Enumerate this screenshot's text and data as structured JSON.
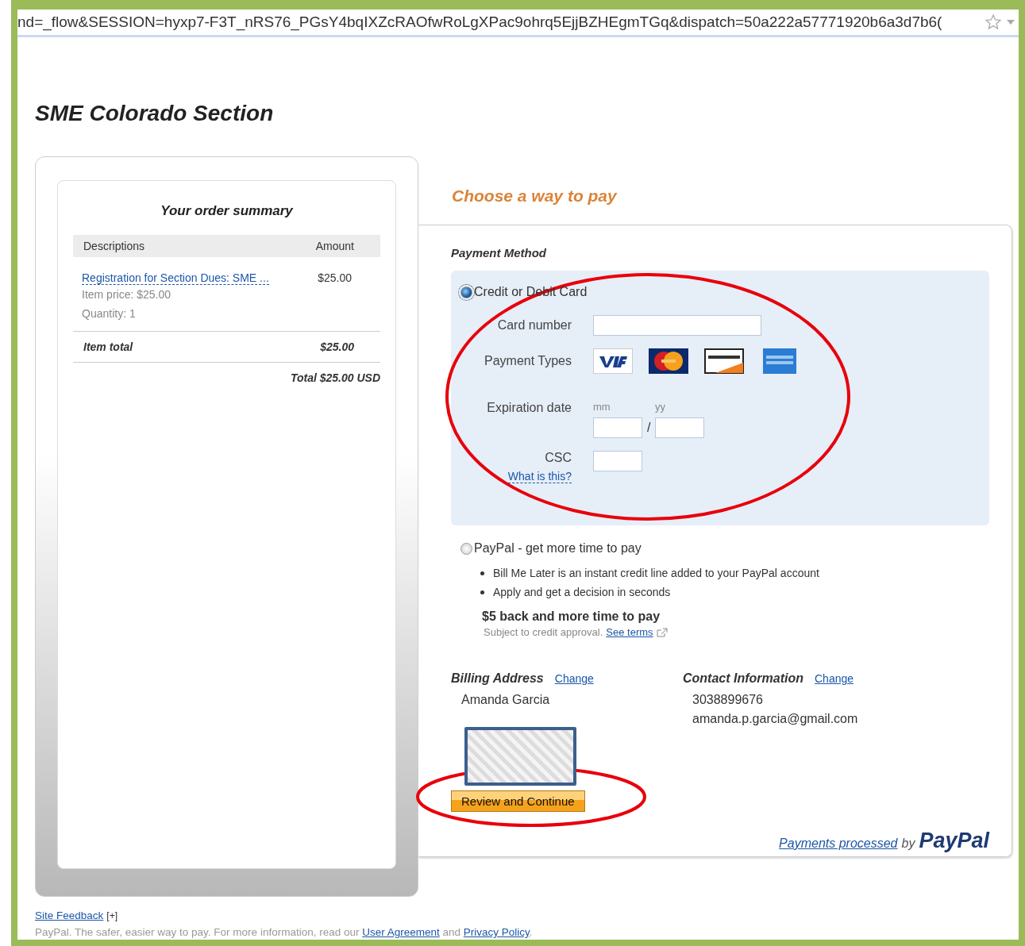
{
  "address_bar": {
    "url": "nd=_flow&SESSION=hyxp7-F3T_nRS76_PGsY4bqIXZcRAOfwRoLgXPac9ohrq5EjjBZHEgmTGq&dispatch=50a222a57771920b6a3d7b6("
  },
  "merchant_title": "SME Colorado Section",
  "order_summary": {
    "title": "Your order summary",
    "columns": [
      "Descriptions",
      "Amount"
    ],
    "items": [
      {
        "name": "Registration for Section Dues: SME ...",
        "amount": "$25.00",
        "price": "Item price: $25.00",
        "quantity": "Quantity: 1"
      }
    ],
    "item_total_label": "Item total",
    "item_total": "$25.00",
    "total": "Total $25.00 USD"
  },
  "payment": {
    "heading": "Choose a way to pay",
    "method_label": "Payment Method",
    "options": [
      {
        "kind": "card",
        "label": "Credit or Debit Card",
        "selected": true,
        "card_number_label": "Card number",
        "payment_types_label": "Payment Types",
        "card_types": [
          {
            "kind": "visa"
          },
          {
            "kind": "mastercard"
          },
          {
            "kind": "discover"
          },
          {
            "kind": "amex"
          }
        ],
        "expiration_label": "Expiration date",
        "month_hint": "mm",
        "year_hint": "yy",
        "separator": "/",
        "csc_label": "CSC",
        "csc_help": "What is this?"
      },
      {
        "kind": "paypal",
        "label": "PayPal - get more time to pay",
        "selected": false,
        "bullets": [
          "Bill Me Later is an instant credit line added to your PayPal account",
          "Apply and get a decision in seconds"
        ],
        "promo_title": "$5 back and more time to pay",
        "promo_note": "Subject to credit approval.",
        "terms_link": "See terms"
      }
    ],
    "billing": {
      "heading": "Billing Address",
      "change": "Change",
      "lines": [
        "Amanda Garcia"
      ]
    },
    "contact": {
      "heading": "Contact Information",
      "change": "Change",
      "lines": [
        "3038899676",
        "amanda.p.garcia@gmail.com"
      ]
    },
    "continue_button": "Review and Continue",
    "processed": {
      "link": "Payments processed",
      "by": "by",
      "brand": "PayPal"
    }
  },
  "footer": {
    "feedback": "Site Feedback",
    "expand": "[+]",
    "notice": "PayPal. The safer, easier way to pay. For more information, read our",
    "user_agreement": "User Agreement",
    "and": "and",
    "privacy": "Privacy Policy",
    "end": "."
  }
}
